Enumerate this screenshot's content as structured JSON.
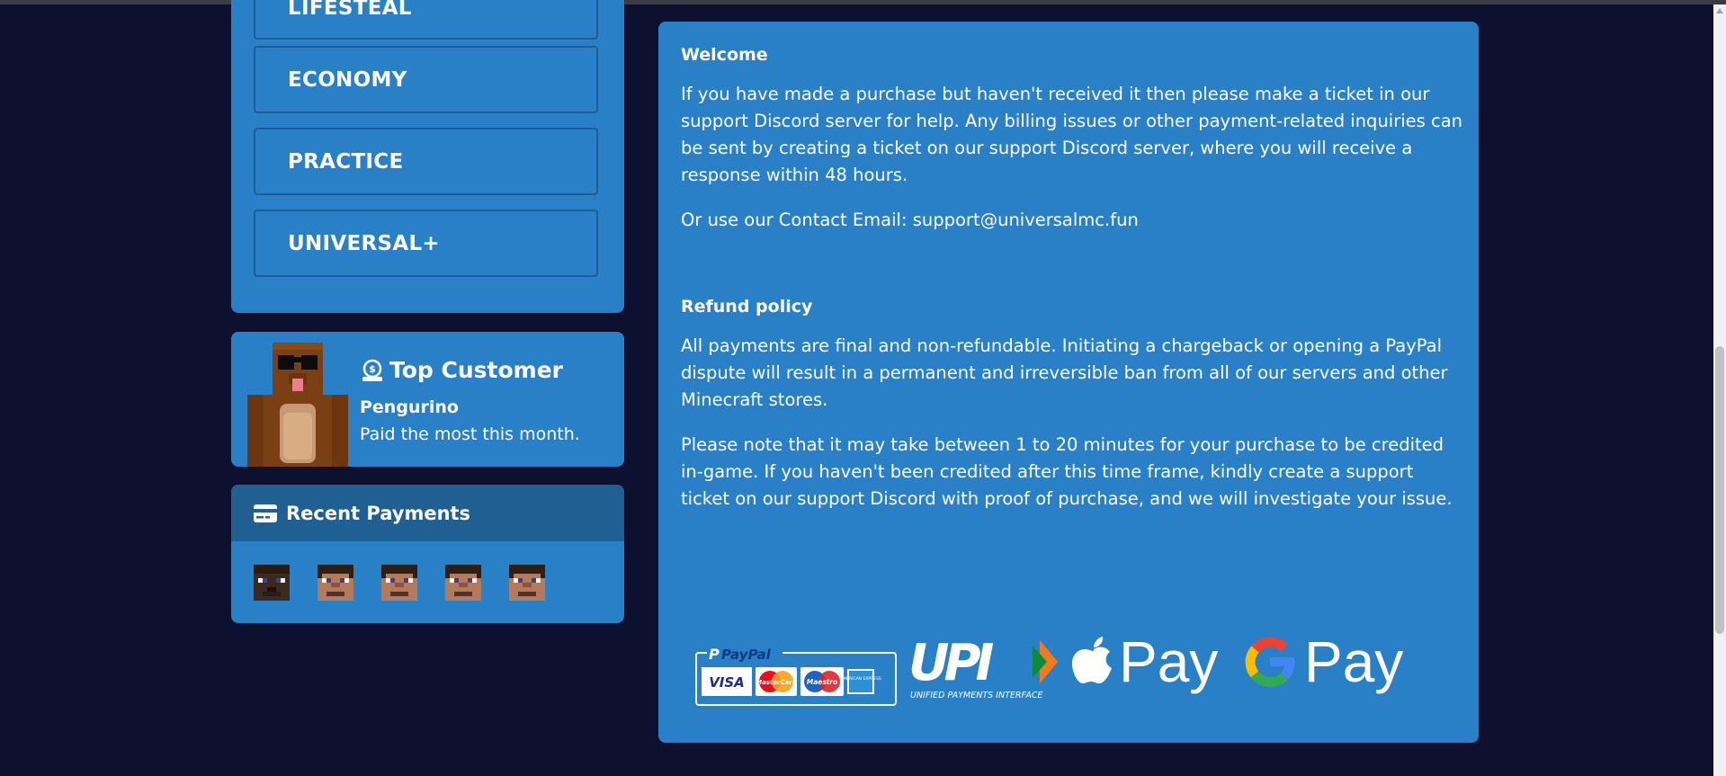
{
  "categories": [
    {
      "label": "LIFESTEAL"
    },
    {
      "label": "ECONOMY"
    },
    {
      "label": "PRACTICE"
    },
    {
      "label": "UNIVERSAL+"
    }
  ],
  "top_customer": {
    "title": "Top Customer",
    "name": "Pengurino",
    "description": "Paid the most this month."
  },
  "recent_payments": {
    "title": "Recent Payments",
    "players": 5
  },
  "info": {
    "welcome_heading": "Welcome",
    "welcome_text": "If you have made a purchase but haven't received it then please make a ticket in our support  Discord server for help. Any billing issues or other payment-related inquiries can be sent by creating a ticket on our support Discord server, where you will receive a response within 48 hours.",
    "contact_text": "Or use our Contact Email: support@universalmc.fun",
    "refund_heading": "Refund policy",
    "refund_text": "All payments are final and non-refundable. Initiating a chargeback or opening a PayPal dispute will result in a permanent and irreversible ban from all of our servers and other Minecraft stores.",
    "credit_text": "Please note that it may take between 1 to 20 minutes for your purchase to be credited in-game. If you haven't been credited after this time frame, kindly create a support ticket on our support Discord with proof of purchase, and we will investigate your issue."
  },
  "payment_methods": {
    "paypal_label": "PayPal",
    "cards": [
      "VISA",
      "MasterCard",
      "Maestro",
      "AMERICAN EXPRESS"
    ],
    "upi_label": "UPI",
    "upi_sub": "UNIFIED PAYMENTS INTERFACE",
    "apple_pay_label": "Pay",
    "google_pay_label": "Pay"
  },
  "colors": {
    "page_bg": "#0e1030",
    "panel": "#2a80c6",
    "panel_header": "#1f5f92",
    "border": "#1f5d95"
  }
}
